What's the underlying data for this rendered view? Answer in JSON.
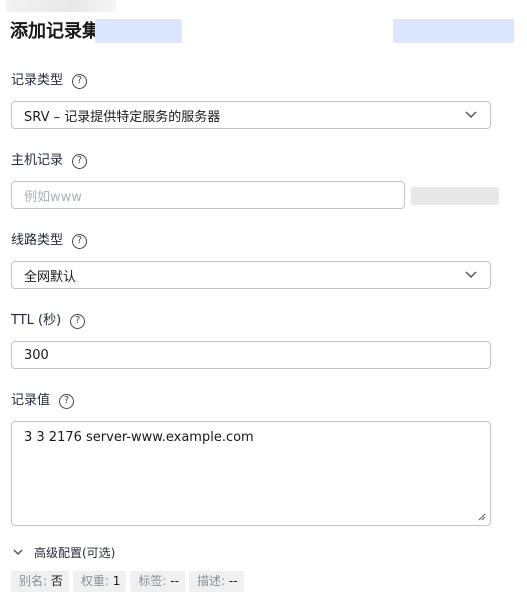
{
  "header": {
    "title": "添加记录集"
  },
  "record_type": {
    "label": "记录类型",
    "value": "SRV – 记录提供特定服务的服务器"
  },
  "host_record": {
    "label": "主机记录",
    "placeholder": "例如www",
    "value": ""
  },
  "line_type": {
    "label": "线路类型",
    "value": "全网默认"
  },
  "ttl": {
    "label": "TTL (秒)",
    "value": "300"
  },
  "record_value": {
    "label": "记录值",
    "value": "3 3 2176 server-www.example.com"
  },
  "advanced": {
    "label": "高级配置(可选)",
    "tags": [
      {
        "key": "别名:",
        "value": "否"
      },
      {
        "key": "权重:",
        "value": "1"
      },
      {
        "key": "标签:",
        "value": "--"
      },
      {
        "key": "描述:",
        "value": "--"
      }
    ]
  },
  "icons": {
    "help": "help-circle-icon",
    "dropdown": "chevron-down-icon",
    "resize": "resize-handle-icon"
  },
  "colors": {
    "border": "#c2c2c2",
    "placeholder": "#adb0b8",
    "tag_background": "#f0f0f0",
    "redaction_blue": "#dbe7ff"
  }
}
